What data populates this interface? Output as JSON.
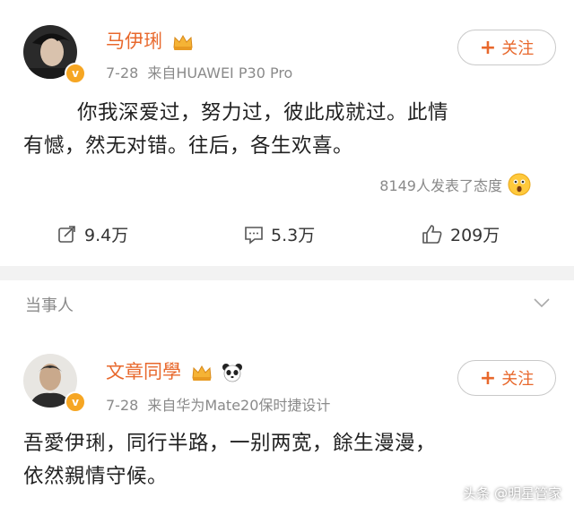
{
  "post1": {
    "username": "马伊琍",
    "date": "7-28",
    "source": "来自HUAWEI P30 Pro",
    "follow_label": "关注",
    "content_line1": "你我深爱过，努力过，彼此成就过。此情",
    "content_line2": "有憾，然无对错。往后，各生欢喜。",
    "reactions_text": "8149人发表了态度",
    "repost_count": "9.4万",
    "comment_count": "5.3万",
    "like_count": "209万"
  },
  "section": {
    "label": "当事人"
  },
  "post2": {
    "username": "文章同學",
    "date": "7-28",
    "source": "来自华为Mate20保时捷设计",
    "follow_label": "关注",
    "content_line1": "吾愛伊琍，同行半路，一别两宽，餘生漫漫，",
    "content_line2": "依然親情守候。"
  },
  "watermark": "头条 @明星管家",
  "colors": {
    "username": "#e8682c",
    "meta": "#8a8a8a",
    "badge": "#f6a623",
    "separator": "#f2f2f2"
  },
  "icons": [
    "repost-icon",
    "comment-icon",
    "like-icon",
    "crown-icon",
    "panda-icon",
    "surprised-emoji-icon",
    "chevron-down-icon",
    "verified-badge-icon"
  ]
}
